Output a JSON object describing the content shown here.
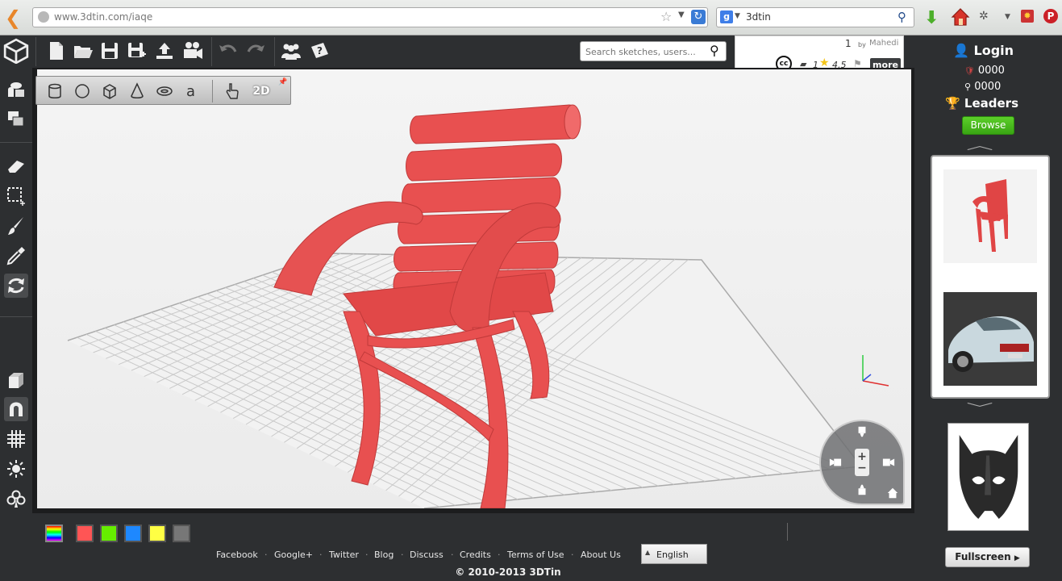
{
  "browser": {
    "url": "www.3dtin.com/iaqe",
    "search_query": "3dtin",
    "search_engine_icon": "google-icon"
  },
  "app": {
    "search_placeholder": "Search sketches, users...",
    "sketch_info": {
      "number": "1",
      "by_label": "by",
      "author": "Mahedi",
      "license": "cc",
      "comment_count": "1",
      "rating": "4.5",
      "more_label": "more"
    },
    "toolbar": {
      "icons": [
        "logo-cube-icon",
        "new-file-icon",
        "open-folder-icon",
        "save-icon",
        "save-as-icon",
        "upload-icon",
        "video-camera-icon",
        "undo-icon",
        "redo-icon",
        "community-icon",
        "help-icon"
      ]
    },
    "shape_bar": {
      "icons": [
        "cylinder-icon",
        "sphere-icon",
        "cube-icon",
        "cone-icon",
        "torus-icon",
        "text-shape-icon",
        "hand-pointer-icon",
        "2d-icon"
      ],
      "mode_2d_label": "2D"
    },
    "left_tools": {
      "icons": [
        "group-icon",
        "layers-icon",
        "eraser-icon",
        "select-box-icon",
        "paint-brush-icon",
        "eyedropper-icon",
        "rotate-icon",
        "box-3d-icon",
        "magnet-icon",
        "grid-icon",
        "light-icon",
        "clubs-icon"
      ]
    },
    "colors": [
      "#ff5555",
      "#66ee00",
      "#1e88ff",
      "#ffff44",
      "#777777"
    ],
    "footer": {
      "links": [
        "Facebook",
        "Google+",
        "Twitter",
        "Blog",
        "Discuss",
        "Credits",
        "Terms of Use",
        "About Us"
      ],
      "language": "English",
      "copyright": "© 2010-2013 3DTin"
    },
    "sidebar": {
      "login_label": "Login",
      "stat1": "0000",
      "stat2": "0000",
      "leaders_label": "Leaders",
      "browse_label": "Browse",
      "fullscreen_label": "Fullscreen"
    },
    "model_color": "#e85050"
  }
}
